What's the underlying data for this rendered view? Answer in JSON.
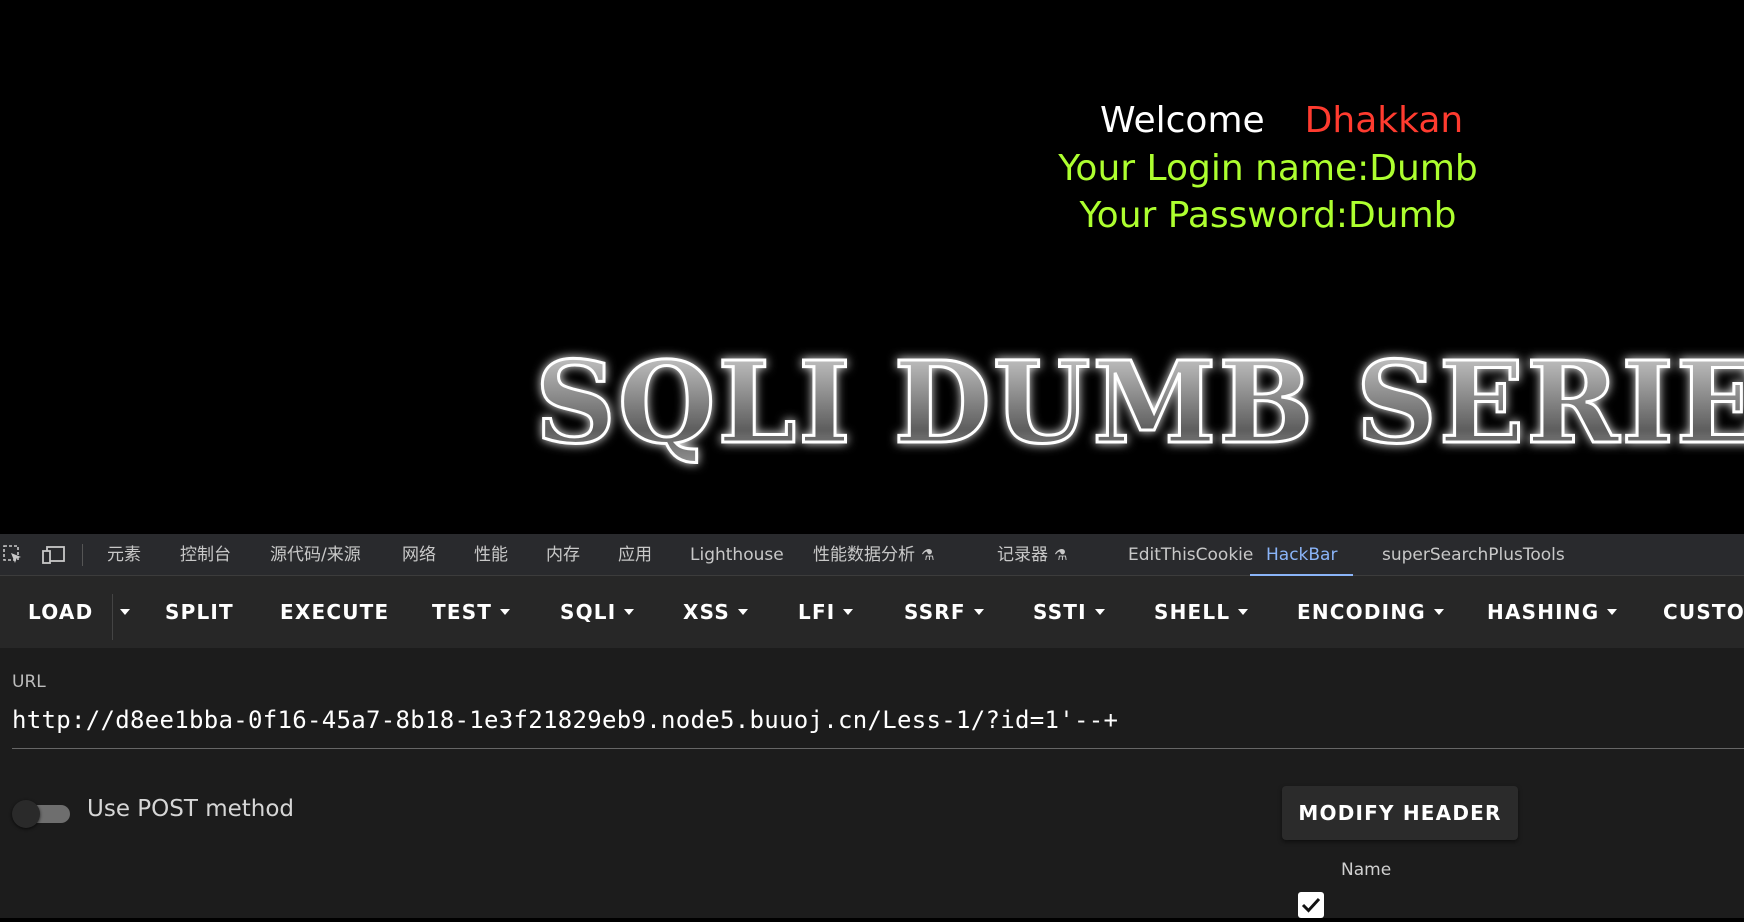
{
  "page": {
    "welcome_word": "Welcome",
    "welcome_user": "Dhakkan",
    "login_line": "Your Login name:Dumb",
    "password_line": "Your Password:Dumb",
    "banner_text": "SQLI DUMB SERIES"
  },
  "devtools": {
    "tabs": [
      {
        "label": "元素"
      },
      {
        "label": "控制台"
      },
      {
        "label": "源代码/来源"
      },
      {
        "label": "网络"
      },
      {
        "label": "性能"
      },
      {
        "label": "内存"
      },
      {
        "label": "应用"
      },
      {
        "label": "Lighthouse"
      },
      {
        "label": "性能数据分析"
      },
      {
        "label": "记录器"
      },
      {
        "label": "EditThisCookie"
      },
      {
        "label": "HackBar"
      },
      {
        "label": "superSearchPlusTools"
      }
    ],
    "active_tab": "HackBar",
    "icons": [
      "inspect-element-icon",
      "device-toolbar-icon",
      "flask-icon"
    ]
  },
  "hackbar": {
    "toolbar": [
      {
        "label": "LOAD"
      },
      {
        "label": "SPLIT"
      },
      {
        "label": "EXECUTE"
      },
      {
        "label": "TEST"
      },
      {
        "label": "SQLI"
      },
      {
        "label": "XSS"
      },
      {
        "label": "LFI"
      },
      {
        "label": "SSRF"
      },
      {
        "label": "SSTI"
      },
      {
        "label": "SHELL"
      },
      {
        "label": "ENCODING"
      },
      {
        "label": "HASHING"
      },
      {
        "label": "CUSTOM"
      }
    ],
    "url_label": "URL",
    "url_value": "http://d8ee1bba-0f16-45a7-8b18-1e3f21829eb9.node5.buuoj.cn/Less-1/?id=1'--+",
    "post_label": "Use POST method",
    "post_enabled": false,
    "modify_header_label": "MODIFY HEADER",
    "header_name_label": "Name",
    "header_checked": true
  },
  "colors": {
    "welcome": "#ffffff",
    "user": "#ff3b2f",
    "login_text": "#adff2f",
    "active_tab": "#8ab4f8"
  }
}
